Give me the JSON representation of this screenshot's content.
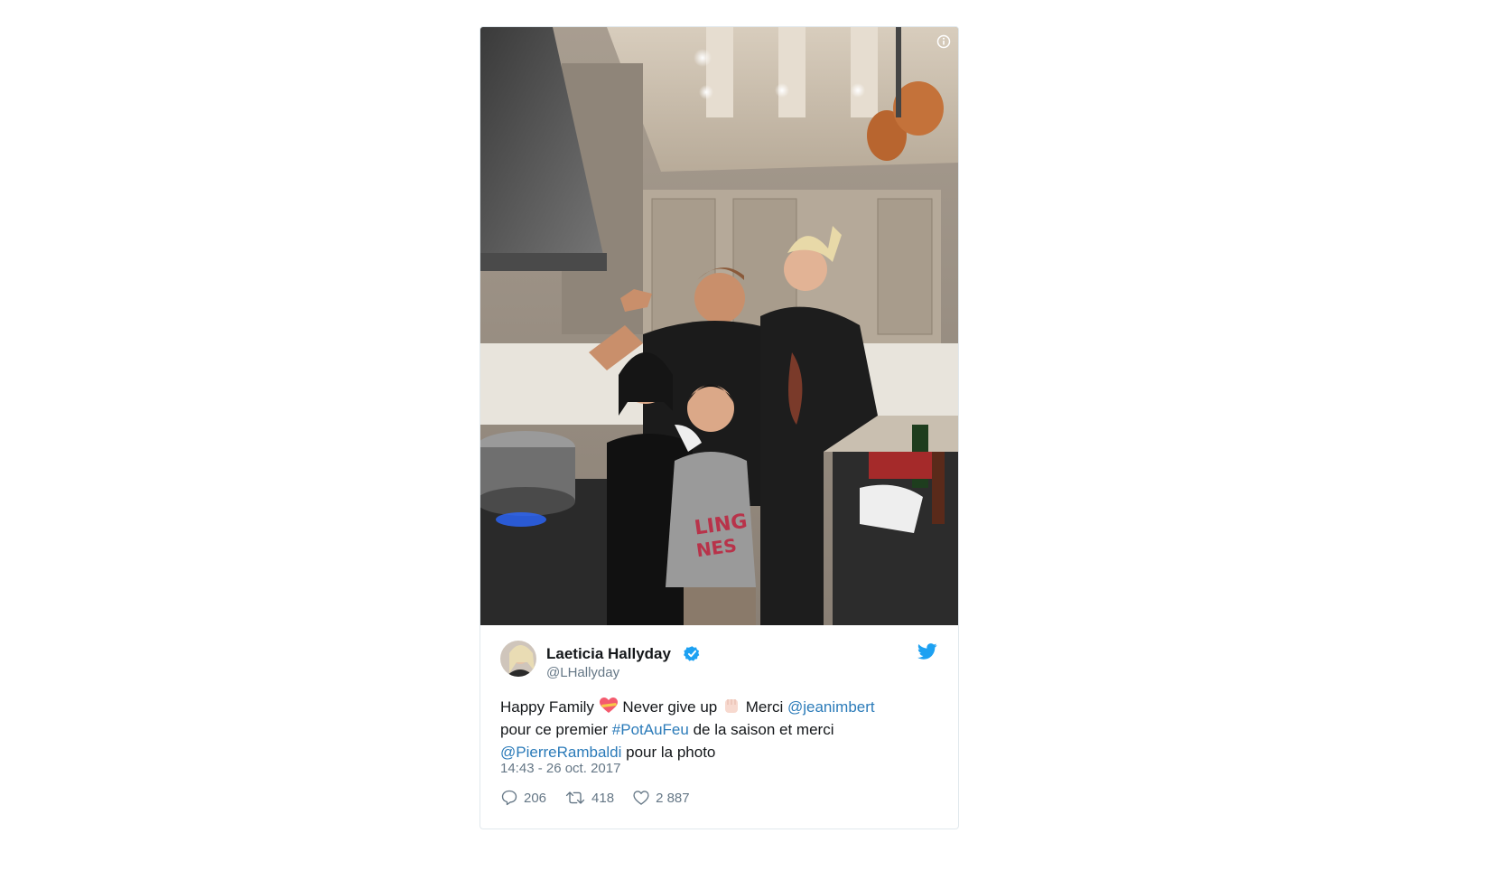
{
  "tweet": {
    "photo": {
      "alt_icon": "info-icon"
    },
    "author": {
      "display_name": "Laeticia Hallyday",
      "handle": "@LHallyday",
      "verified_icon": "verified-badge-icon",
      "avatar_icon": "avatar"
    },
    "text": {
      "part1": "Happy Family ",
      "emoji1": "heart-emoji",
      "part2": " Never give up ",
      "emoji2": "raised-fist-emoji",
      "part3": " Merci ",
      "mention1": "@jeanimbert",
      "part4": " pour ce premier ",
      "hashtag": "#PotAuFeu",
      "part5": " de la saison et merci ",
      "mention2": "@PierreRambaldi",
      "part6": " pour la photo"
    },
    "timestamp": "14:43 - 26 oct. 2017",
    "actions": {
      "replies": "206",
      "retweets": "418",
      "likes": "2 887"
    }
  },
  "colors": {
    "link": "#2b7bb9",
    "twitter_blue": "#1da1f2",
    "muted": "#657786",
    "border": "#e1e8ed"
  }
}
